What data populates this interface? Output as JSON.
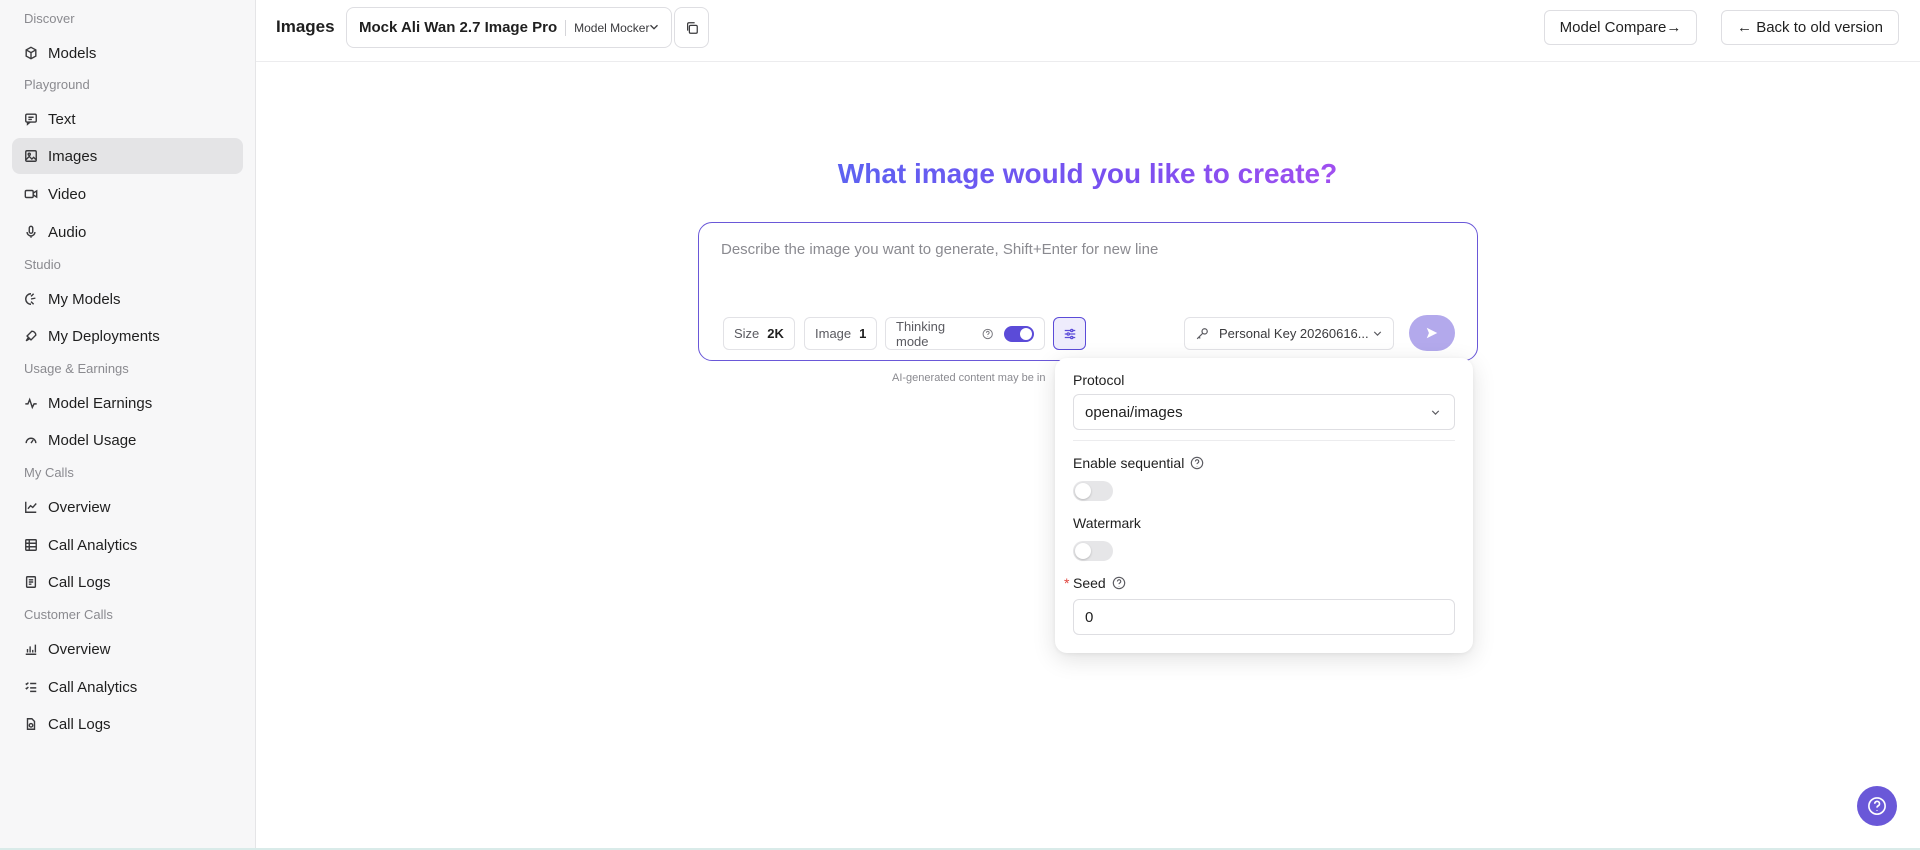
{
  "sidebar": {
    "sections": [
      "Discover",
      "Playground",
      "Studio",
      "Usage & Earnings",
      "My Calls",
      "Customer Calls"
    ],
    "items": [
      {
        "label": "Models",
        "icon": "cube-icon"
      },
      {
        "label": "Text",
        "icon": "chat-icon"
      },
      {
        "label": "Images",
        "icon": "image-icon",
        "active": true
      },
      {
        "label": "Video",
        "icon": "video-icon"
      },
      {
        "label": "Audio",
        "icon": "mic-icon"
      },
      {
        "label": "My Models",
        "icon": "model-icon"
      },
      {
        "label": "My Deployments",
        "icon": "rocket-icon"
      },
      {
        "label": "Model Earnings",
        "icon": "pulse-icon"
      },
      {
        "label": "Model Usage",
        "icon": "gauge-icon"
      },
      {
        "label": "Overview",
        "icon": "line-chart-icon"
      },
      {
        "label": "Call Analytics",
        "icon": "table-icon"
      },
      {
        "label": "Call Logs",
        "icon": "logs-icon"
      },
      {
        "label": "Overview",
        "icon": "bar-chart-icon"
      },
      {
        "label": "Call Analytics",
        "icon": "list-icon"
      },
      {
        "label": "Call Logs",
        "icon": "document-icon"
      }
    ]
  },
  "header": {
    "title": "Images",
    "model_name": "Mock Ali Wan 2.7 Image Pro",
    "model_provider": "Model Mocker",
    "compare_label": "Model Compare→",
    "back_label": "←  Back to old version"
  },
  "main": {
    "hero": "What image would you like to create?",
    "prompt_placeholder": "Describe the image you want to generate, Shift+Enter for new line",
    "size_label": "Size",
    "size_value": "2K",
    "image_label": "Image",
    "image_value": "1",
    "thinking_label": "Thinking mode",
    "thinking_on": true,
    "key_label": "Personal Key 20260616...",
    "disclaimer": "AI-generated content may be in"
  },
  "popover": {
    "protocol_label": "Protocol",
    "protocol_value": "openai/images",
    "sequential_label": "Enable sequential",
    "sequential_on": false,
    "watermark_label": "Watermark",
    "watermark_on": false,
    "seed_label": "Seed",
    "seed_value": "0"
  },
  "colors": {
    "accent": "#5b4bd8",
    "send_disabled": "#b3a9ec",
    "active_nav": "#e4e4e6"
  }
}
